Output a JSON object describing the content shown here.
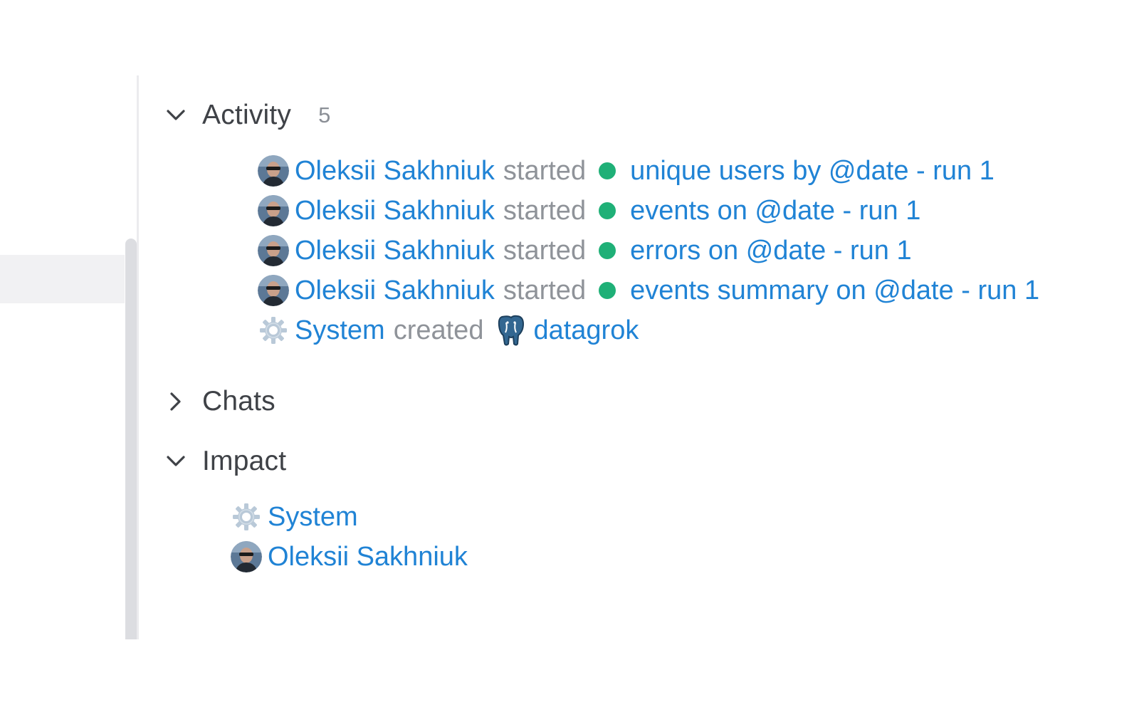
{
  "activity": {
    "title": "Activity",
    "count": "5",
    "expanded": true,
    "items": [
      {
        "user": "Oleksii Sakhniuk",
        "action": "started",
        "target": "unique users by @date - run 1",
        "user_icon": "avatar",
        "target_icon": "status-dot-icon",
        "status_color": "#1fb077"
      },
      {
        "user": "Oleksii Sakhniuk",
        "action": "started",
        "target": "events on @date - run 1",
        "user_icon": "avatar",
        "target_icon": "status-dot-icon",
        "status_color": "#1fb077"
      },
      {
        "user": "Oleksii Sakhniuk",
        "action": "started",
        "target": "errors on @date - run 1",
        "user_icon": "avatar",
        "target_icon": "status-dot-icon",
        "status_color": "#1fb077"
      },
      {
        "user": "Oleksii Sakhniuk",
        "action": "started",
        "target": "events summary on @date - run 1",
        "user_icon": "avatar",
        "target_icon": "status-dot-icon",
        "status_color": "#1fb077"
      },
      {
        "user": "System",
        "action": "created",
        "target": "datagrok",
        "user_icon": "gear-icon",
        "target_icon": "postgres-elephant-icon"
      }
    ]
  },
  "chats": {
    "title": "Chats",
    "expanded": false
  },
  "impact": {
    "title": "Impact",
    "expanded": true,
    "items": [
      {
        "name": "System",
        "icon": "gear-icon"
      },
      {
        "name": "Oleksii Sakhniuk",
        "icon": "avatar"
      }
    ]
  },
  "colors": {
    "link": "#2083d5",
    "verb": "#8f9399",
    "title": "#3f4247",
    "status_ok": "#1fb077"
  }
}
